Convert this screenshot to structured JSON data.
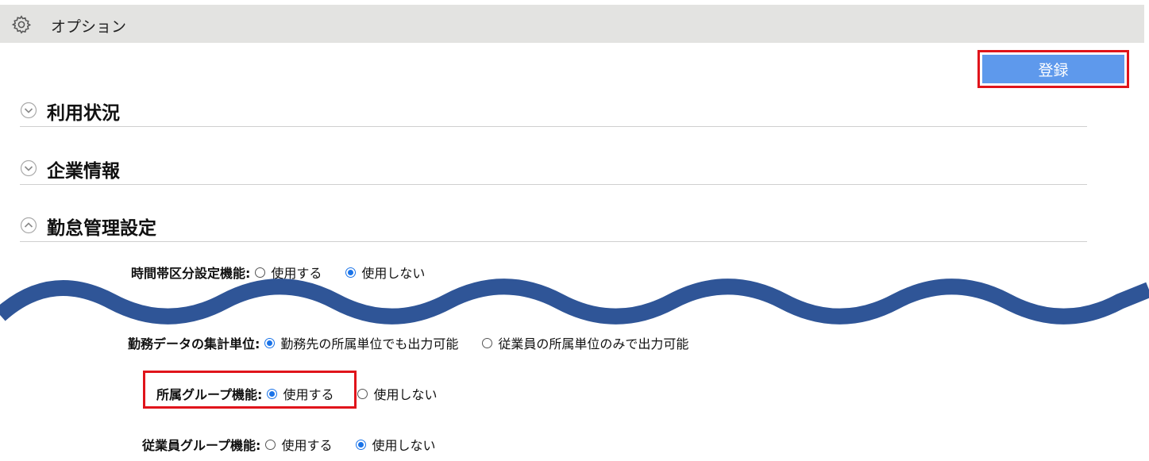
{
  "titlebar": {
    "title": "オプション",
    "icon": "gear-icon"
  },
  "toolbar": {
    "register_label": "登録",
    "register_color": "#5e99ec",
    "highlight_color": "#e0141b"
  },
  "sections": [
    {
      "label": "利用状況",
      "state": "collapsed"
    },
    {
      "label": "企業情報",
      "state": "collapsed"
    },
    {
      "label": "勤怠管理設定",
      "state": "expanded"
    }
  ],
  "settings": {
    "timeband": {
      "label": "時間帯区分設定機能:",
      "options": [
        "使用する",
        "使用しない"
      ],
      "selected": "使用しない"
    },
    "aggregate": {
      "label": "勤務データの集計単位:",
      "options": [
        "勤務先の所属単位でも出力可能",
        "従業員の所属単位のみで出力可能"
      ],
      "selected": "勤務先の所属単位でも出力可能"
    },
    "affiliation_group": {
      "label": "所属グループ機能:",
      "options": [
        "使用する",
        "使用しない"
      ],
      "selected": "使用する"
    },
    "employee_group": {
      "label": "従業員グループ機能:",
      "options": [
        "使用する",
        "使用しない"
      ],
      "selected": "使用しない"
    }
  },
  "wave_color": "#2f5597"
}
